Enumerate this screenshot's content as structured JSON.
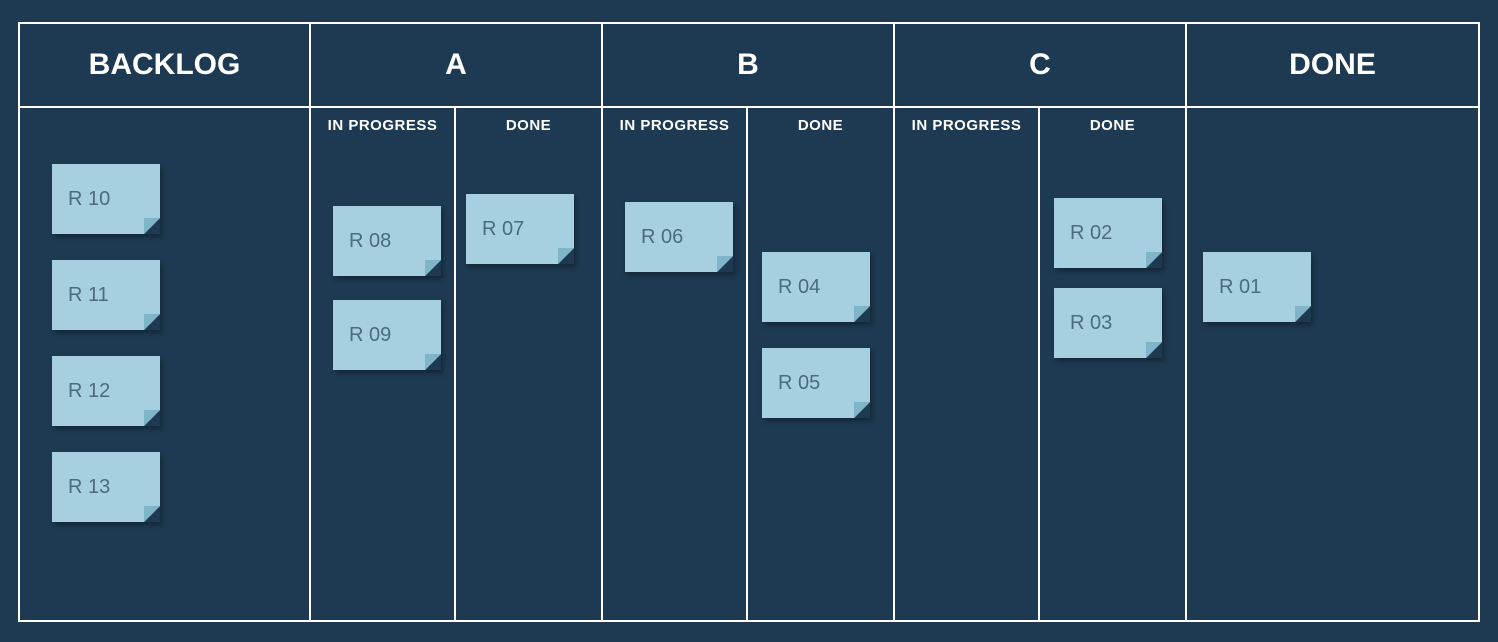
{
  "columns": {
    "backlog": {
      "title": "BACKLOG",
      "cards": [
        "R 10",
        "R 11",
        "R 12",
        "R 13"
      ]
    },
    "a": {
      "title": "A",
      "in_progress": {
        "label": "IN PROGRESS",
        "cards": [
          "R 08",
          "R 09"
        ]
      },
      "done": {
        "label": "DONE",
        "cards": [
          "R 07"
        ]
      }
    },
    "b": {
      "title": "B",
      "in_progress": {
        "label": "IN PROGRESS",
        "cards": [
          "R 06"
        ]
      },
      "done": {
        "label": "DONE",
        "cards": [
          "R 04",
          "R 05"
        ]
      }
    },
    "c": {
      "title": "C",
      "in_progress": {
        "label": "IN PROGRESS",
        "cards": []
      },
      "done": {
        "label": "DONE",
        "cards": [
          "R 02",
          "R 03"
        ]
      }
    },
    "done": {
      "title": "DONE",
      "cards": [
        "R 01"
      ]
    }
  }
}
